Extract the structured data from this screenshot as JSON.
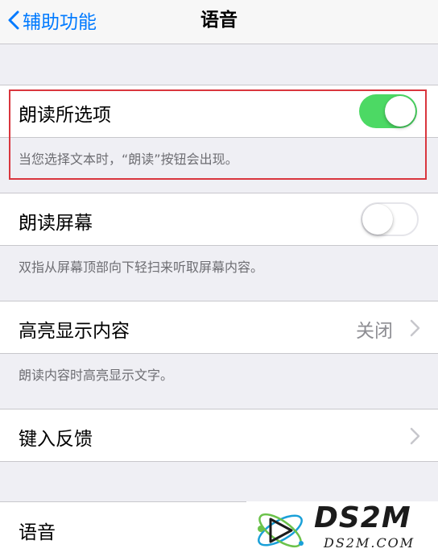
{
  "nav": {
    "back_label": "辅助功能",
    "title": "语音"
  },
  "speak_selection": {
    "label": "朗读所选项",
    "enabled": true,
    "footer": "当您选择文本时，“朗读”按钮会出现。"
  },
  "speak_screen": {
    "label": "朗读屏幕",
    "enabled": false,
    "footer": "双指从屏幕顶部向下轻扫来听取屏幕内容。"
  },
  "highlight_content": {
    "label": "高亮显示内容",
    "value": "关闭",
    "footer": "朗读内容时高亮显示文字。"
  },
  "typing_feedback": {
    "label": "键入反馈"
  },
  "voices": {
    "label": "语音"
  },
  "watermark": {
    "word": "DS2M",
    "domain": "DS2M.COM"
  },
  "colors": {
    "accent": "#007aff",
    "toggle_on": "#4cd964",
    "highlight_border": "#d9363e",
    "group_background": "#efeff4"
  },
  "icons": {
    "back": "chevron-left-icon",
    "disclosure": "chevron-right-icon",
    "logo": "atom-orbit-logo"
  }
}
